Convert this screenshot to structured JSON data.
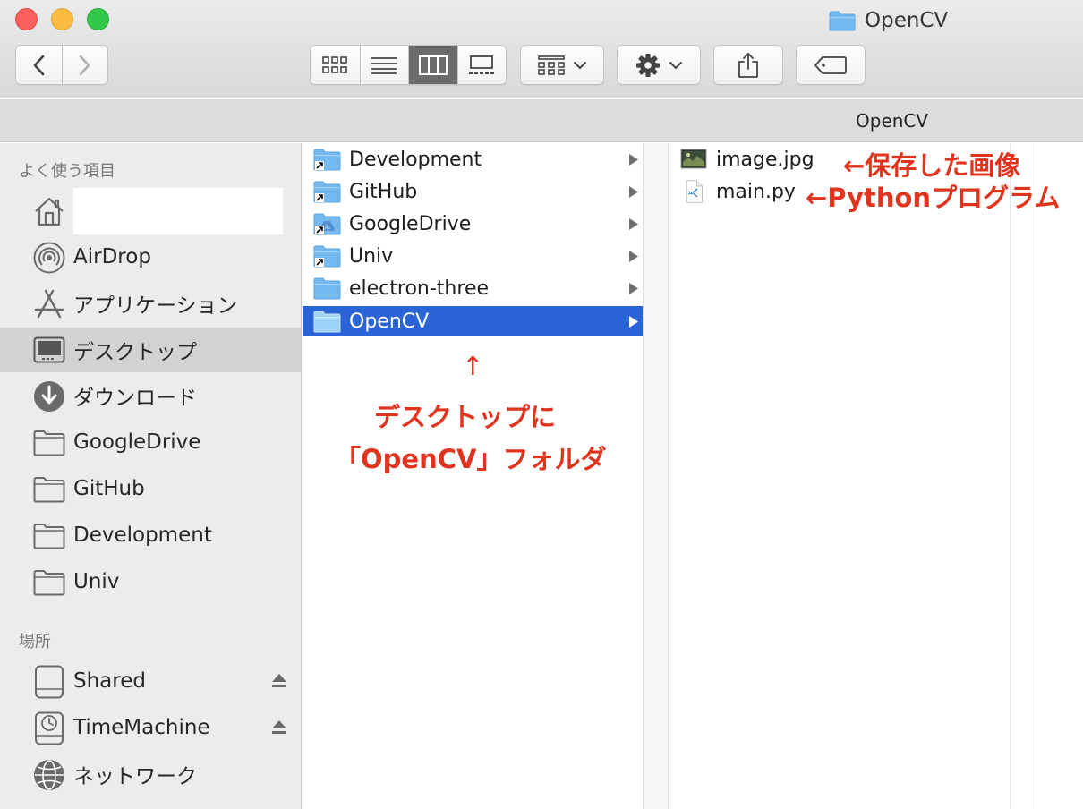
{
  "window": {
    "title": "OpenCV",
    "traffic_lights": [
      "close",
      "minimize",
      "zoom"
    ]
  },
  "toolbar": {
    "nav": [
      "back",
      "forward"
    ],
    "view_modes": [
      "icon-view",
      "list-view",
      "column-view",
      "gallery-view"
    ],
    "active_view": "column-view",
    "buttons": [
      "arrange-menu",
      "action-menu",
      "share",
      "tags"
    ]
  },
  "pathbar": {
    "label": "OpenCV"
  },
  "sidebar": {
    "favorites_header": "よく使う項目",
    "favorites": [
      {
        "label": "",
        "icon": "home-icon"
      },
      {
        "label": "AirDrop",
        "icon": "airdrop-icon"
      },
      {
        "label": "アプリケーション",
        "icon": "applications-icon"
      },
      {
        "label": "デスクトップ",
        "icon": "desktop-icon",
        "selected": true
      },
      {
        "label": "ダウンロード",
        "icon": "downloads-icon"
      },
      {
        "label": "GoogleDrive",
        "icon": "folder-icon"
      },
      {
        "label": "GitHub",
        "icon": "folder-icon"
      },
      {
        "label": "Development",
        "icon": "folder-icon"
      },
      {
        "label": "Univ",
        "icon": "folder-icon"
      }
    ],
    "locations_header": "場所",
    "locations": [
      {
        "label": "Shared",
        "icon": "drive-icon",
        "eject": true
      },
      {
        "label": "TimeMachine",
        "icon": "timemachine-icon",
        "eject": true
      },
      {
        "label": "ネットワーク",
        "icon": "network-icon"
      }
    ]
  },
  "column1": {
    "items": [
      {
        "label": "Development",
        "alias": true
      },
      {
        "label": "GitHub",
        "alias": true
      },
      {
        "label": "GoogleDrive",
        "alias": true
      },
      {
        "label": "Univ",
        "alias": true
      },
      {
        "label": "electron-three",
        "alias": false
      },
      {
        "label": "OpenCV",
        "alias": false,
        "selected": true
      }
    ]
  },
  "column2": {
    "files": [
      {
        "label": "image.jpg",
        "icon": "image-file-icon"
      },
      {
        "label": "main.py",
        "icon": "python-file-icon"
      }
    ]
  },
  "annotations": {
    "image_note": "←保存した画像",
    "python_note": "←Pythonプログラム",
    "up_arrow": "↑",
    "desktop_note_line1": "デスクトップに",
    "desktop_note_line2": "「OpenCV」フォルダ",
    "color": "#e0341f"
  },
  "colors": {
    "selection_blue": "#2a64d6",
    "sidebar_bg": "#ececec",
    "sidebar_selected": "#d2d2d2",
    "folder_blue": "#74b9f0"
  }
}
